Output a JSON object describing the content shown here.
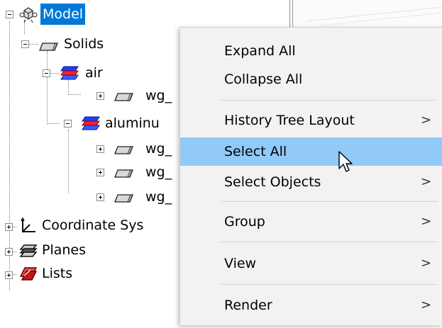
{
  "tree": {
    "root": {
      "label": "Model"
    },
    "solids": {
      "label": "Solids"
    },
    "air": {
      "label": "air"
    },
    "air_child": {
      "label": "wg_"
    },
    "aluminum": {
      "label": "aluminu"
    },
    "aluminum_children": [
      {
        "label": "wg_"
      },
      {
        "label": "wg_"
      },
      {
        "label": "wg_"
      }
    ],
    "coordinate_systems": {
      "label": "Coordinate Sys"
    },
    "planes": {
      "label": "Planes"
    },
    "lists": {
      "label": "Lists"
    }
  },
  "context_menu": {
    "items": [
      {
        "label": "Expand All",
        "submenu": false
      },
      {
        "label": "Collapse All",
        "submenu": false
      },
      {
        "label": "History Tree Layout",
        "submenu": true,
        "arrow": ">"
      },
      {
        "label": "Select All",
        "submenu": false,
        "hovered": true
      },
      {
        "label": "Select Objects",
        "submenu": true,
        "arrow": ">"
      },
      {
        "label": "Group",
        "submenu": true,
        "arrow": ">"
      },
      {
        "label": "View",
        "submenu": true,
        "arrow": ">"
      },
      {
        "label": "Render",
        "submenu": true,
        "arrow": ">"
      }
    ]
  },
  "colors": {
    "selection": "#0078d7",
    "menu_hover": "#91c9f7",
    "menu_background": "#f2f2f2"
  }
}
